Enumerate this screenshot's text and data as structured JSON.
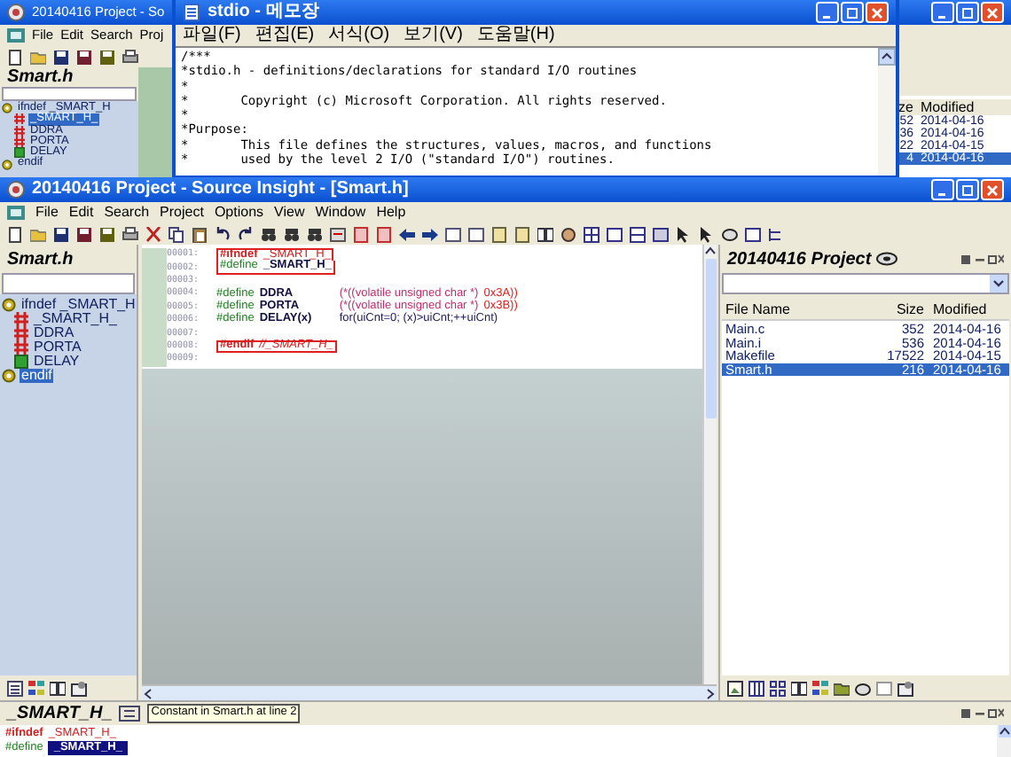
{
  "back_window": {
    "title": "20140416 Project - So",
    "menu": [
      "File",
      "Edit",
      "Search",
      "Proj"
    ],
    "panel_title": "Smart.h",
    "symbols": [
      {
        "label": "ifndef _SMART_H",
        "kind": "conditional",
        "selected": false,
        "children": [
          {
            "label": "_SMART_H_",
            "kind": "constant",
            "selected": true
          },
          {
            "label": "DDRA",
            "kind": "constant",
            "selected": false
          },
          {
            "label": "PORTA",
            "kind": "constant",
            "selected": false
          },
          {
            "label": "DELAY",
            "kind": "macro",
            "selected": false
          }
        ]
      },
      {
        "label": "endif",
        "kind": "conditional",
        "selected": false
      }
    ],
    "file_columns": [
      "ze",
      "Modified"
    ],
    "file_rows": [
      {
        "cells": [
          "52",
          "2014-04-16"
        ],
        "selected": false
      },
      {
        "cells": [
          "36",
          "2014-04-16"
        ],
        "selected": false
      },
      {
        "cells": [
          "22",
          "2014-04-15"
        ],
        "selected": false
      },
      {
        "cells": [
          "4",
          "2014-04-16"
        ],
        "selected": true
      }
    ]
  },
  "notepad": {
    "title": "stdio - 메모장",
    "menu": [
      "파일(F)",
      "편집(E)",
      "서식(O)",
      "보기(V)",
      "도움말(H)"
    ],
    "lines": [
      "/***",
      "*stdio.h - definitions/declarations for standard I/O routines",
      "*",
      "*       Copyright (c) Microsoft Corporation. All rights reserved.",
      "*",
      "*Purpose:",
      "*       This file defines the structures, values, macros, and functions",
      "*       used by the level 2 I/O (\"standard I/O\") routines."
    ]
  },
  "main_window": {
    "title": "20140416 Project - Source Insight - [Smart.h]",
    "menu": [
      "File",
      "Edit",
      "Search",
      "Project",
      "Options",
      "View",
      "Window",
      "Help"
    ],
    "panel_title": "Smart.h",
    "symbols": [
      {
        "label": "ifndef _SMART_H",
        "kind": "conditional",
        "selected": false,
        "children": [
          {
            "label": "_SMART_H_",
            "kind": "constant",
            "selected": false
          },
          {
            "label": "DDRA",
            "kind": "constant",
            "selected": false
          },
          {
            "label": "PORTA",
            "kind": "constant",
            "selected": false
          },
          {
            "label": "DELAY",
            "kind": "macro",
            "selected": false
          }
        ]
      },
      {
        "label": "endif",
        "kind": "conditional",
        "selected": true
      }
    ],
    "editor": {
      "lines": [
        {
          "number": "00001:",
          "boxed": true,
          "segments": [
            {
              "text": "#ifndef",
              "kind": "conditional"
            },
            {
              "text": "_SMART_H_",
              "kind": "condname"
            }
          ]
        },
        {
          "number": "00002:",
          "boxed": true,
          "segments": [
            {
              "text": "#define",
              "kind": "define"
            },
            {
              "text": "_SMART_H_",
              "kind": "symbol"
            }
          ]
        },
        {
          "number": "00003:",
          "boxed": false
        },
        {
          "number": "00004:",
          "boxed": false,
          "segments": [
            {
              "text": "#define",
              "kind": "define"
            },
            {
              "text": "DDRA",
              "kind": "symbol"
            },
            {
              "text": "(*((volatile unsigned char *)",
              "kind": "expr"
            },
            {
              "text": "0x3A))",
              "kind": "number"
            }
          ]
        },
        {
          "number": "00005:",
          "boxed": false,
          "segments": [
            {
              "text": "#define",
              "kind": "define"
            },
            {
              "text": "PORTA",
              "kind": "symbol"
            },
            {
              "text": "(*((volatile unsigned char *)",
              "kind": "expr"
            },
            {
              "text": "0x3B))",
              "kind": "number"
            }
          ]
        },
        {
          "number": "00006:",
          "boxed": false,
          "segments": [
            {
              "text": "#define",
              "kind": "define"
            },
            {
              "text": "DELAY(x)",
              "kind": "symbol"
            },
            {
              "text": "for(uiCnt=0; (x)>uiCnt;++uiCnt)",
              "kind": "code"
            }
          ]
        },
        {
          "number": "00007:",
          "boxed": false
        },
        {
          "number": "00008:",
          "boxed": true,
          "segments": [
            {
              "text": "#endif",
              "kind": "conditional"
            },
            {
              "text": "//_SMART_H_",
              "kind": "comment"
            }
          ]
        },
        {
          "number": "00009:",
          "boxed": false
        }
      ]
    },
    "project": {
      "title": "20140416 Project",
      "columns": [
        "File Name",
        "Size",
        "Modified"
      ],
      "rows": [
        {
          "cells": [
            "Main.c",
            "352",
            "2014-04-16"
          ],
          "selected": false
        },
        {
          "cells": [
            "Main.i",
            "536",
            "2014-04-16"
          ],
          "selected": false
        },
        {
          "cells": [
            "Makefile",
            "17522",
            "2014-04-15"
          ],
          "selected": false
        },
        {
          "cells": [
            "Smart.h",
            "216",
            "2014-04-16"
          ],
          "selected": true
        }
      ]
    },
    "context": {
      "symbol": "_SMART_H_",
      "tooltip": "Constant in Smart.h at line 2",
      "lines": [
        {
          "segments": [
            {
              "text": "#ifndef",
              "kind": "conditional",
              "highlighted": false
            },
            {
              "text": "_SMART_H_",
              "kind": "condname",
              "highlighted": false
            }
          ]
        },
        {
          "segments": [
            {
              "text": "#define",
              "kind": "define",
              "highlighted": false
            },
            {
              "text": "_SMART_H_",
              "kind": "symbol",
              "highlighted": true
            }
          ]
        }
      ]
    }
  }
}
